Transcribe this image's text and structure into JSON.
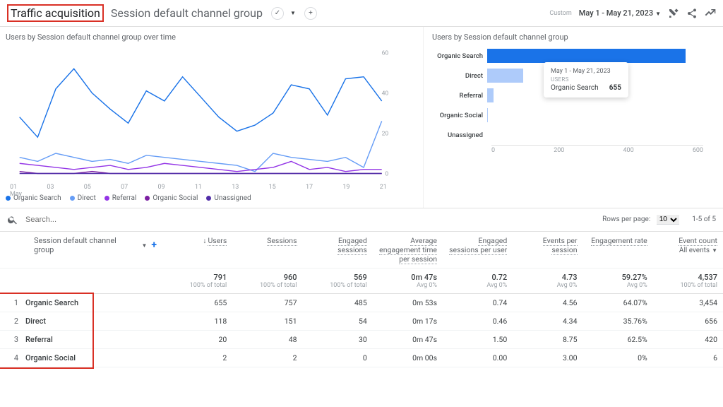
{
  "header": {
    "title": "Traffic acquisition",
    "subtitle": "Session default channel group",
    "custom_label": "Custom",
    "date_range": "May 1 - May 21, 2023"
  },
  "chart_left": {
    "title": "Users by Session default channel group over time"
  },
  "chart_right": {
    "title": "Users by Session default channel group"
  },
  "chart_data": [
    {
      "type": "line",
      "title": "Users by Session default channel group over time",
      "xlabel": "May",
      "ylabel": "",
      "ylim": [
        0,
        60
      ],
      "x": [
        "01",
        "02",
        "03",
        "04",
        "05",
        "06",
        "07",
        "08",
        "09",
        "10",
        "11",
        "12",
        "13",
        "14",
        "15",
        "16",
        "17",
        "18",
        "19",
        "20",
        "21"
      ],
      "series": [
        {
          "name": "Organic Search",
          "color": "#1a73e8",
          "values": [
            28,
            18,
            42,
            52,
            40,
            32,
            25,
            41,
            36,
            48,
            38,
            28,
            21,
            24,
            30,
            44,
            42,
            29,
            47,
            48,
            36
          ]
        },
        {
          "name": "Direct",
          "color": "#669df6",
          "values": [
            8,
            6,
            10,
            8,
            6,
            7,
            5,
            9,
            8,
            7,
            6,
            5,
            4,
            1,
            10,
            8,
            7,
            6,
            8,
            3,
            26
          ]
        },
        {
          "name": "Referral",
          "color": "#9334e6",
          "values": [
            5,
            4,
            3,
            2,
            3,
            4,
            2,
            3,
            5,
            4,
            3,
            2,
            1,
            2,
            3,
            6,
            2,
            3,
            1,
            2,
            2
          ]
        },
        {
          "name": "Organic Social",
          "color": "#7b1fa2",
          "values": [
            1,
            0,
            0,
            0,
            1,
            0,
            0,
            0,
            0,
            0,
            0,
            0,
            0,
            0,
            0,
            0,
            0,
            0,
            0,
            0,
            0
          ]
        },
        {
          "name": "Unassigned",
          "color": "#512da8",
          "values": [
            0,
            0,
            0,
            0,
            0,
            0,
            0,
            0,
            0,
            0,
            0,
            0,
            0,
            0,
            0,
            0,
            0,
            0,
            0,
            0,
            0
          ]
        }
      ],
      "x_ticks": [
        "01",
        "03",
        "05",
        "07",
        "09",
        "11",
        "13",
        "15",
        "17",
        "19",
        "21"
      ]
    },
    {
      "type": "bar",
      "title": "Users by Session default channel group",
      "orientation": "horizontal",
      "categories": [
        "Organic Search",
        "Direct",
        "Referral",
        "Organic Social",
        "Unassigned"
      ],
      "values": [
        655,
        118,
        20,
        2,
        0
      ],
      "xlim": [
        0,
        700
      ],
      "x_ticks": [
        0,
        200,
        400,
        600
      ],
      "tooltip": {
        "date": "May 1 - May 21, 2023",
        "metric": "USERS",
        "label": "Organic Search",
        "value": "655"
      }
    }
  ],
  "legend": [
    "Organic Search",
    "Direct",
    "Referral",
    "Organic Social",
    "Unassigned"
  ],
  "legend_colors": {
    "Organic Search": "#1a73e8",
    "Direct": "#669df6",
    "Referral": "#9334e6",
    "Organic Social": "#7b1fa2",
    "Unassigned": "#512da8"
  },
  "search": {
    "placeholder": "Search..."
  },
  "pager": {
    "rpp_label": "Rows per page:",
    "rpp_value": "10",
    "range": "1-5 of 5"
  },
  "table": {
    "dim_header": "Session default channel group",
    "event_filter": "All events",
    "columns": [
      "Users",
      "Sessions",
      "Engaged sessions",
      "Average engagement time per session",
      "Engaged sessions per user",
      "Events per session",
      "Engagement rate",
      "Event count"
    ],
    "summary": {
      "Users": {
        "v": "791",
        "s": "100% of total"
      },
      "Sessions": {
        "v": "960",
        "s": "100% of total"
      },
      "Engaged sessions": {
        "v": "569",
        "s": "100% of total"
      },
      "Average engagement time per session": {
        "v": "0m 47s",
        "s": "Avg 0%"
      },
      "Engaged sessions per user": {
        "v": "0.72",
        "s": "Avg 0%"
      },
      "Events per session": {
        "v": "4.73",
        "s": "Avg 0%"
      },
      "Engagement rate": {
        "v": "59.27%",
        "s": "Avg 0%"
      },
      "Event count": {
        "v": "4,537",
        "s": "100% of total"
      }
    },
    "rows": [
      {
        "n": "1",
        "dim": "Organic Search",
        "cells": [
          "655",
          "757",
          "485",
          "0m 53s",
          "0.74",
          "4.56",
          "64.07%",
          "3,454"
        ]
      },
      {
        "n": "2",
        "dim": "Direct",
        "cells": [
          "118",
          "151",
          "54",
          "0m 17s",
          "0.46",
          "4.34",
          "35.76%",
          "656"
        ]
      },
      {
        "n": "3",
        "dim": "Referral",
        "cells": [
          "20",
          "48",
          "30",
          "0m 47s",
          "1.50",
          "8.75",
          "62.5%",
          "420"
        ]
      },
      {
        "n": "4",
        "dim": "Organic Social",
        "cells": [
          "2",
          "2",
          "0",
          "0m 00s",
          "0.00",
          "3.00",
          "0%",
          "6"
        ]
      }
    ]
  }
}
